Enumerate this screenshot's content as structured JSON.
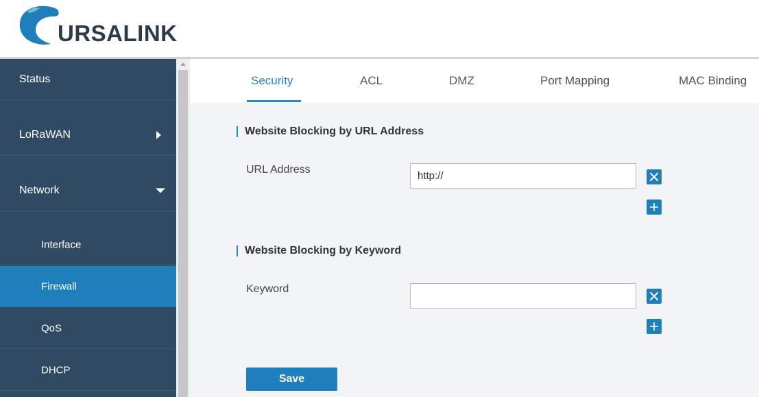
{
  "brand": {
    "logo_text": "URSALINK",
    "accent": "#1f7fba",
    "sidebar_bg": "#304a63"
  },
  "sidebar": {
    "items": [
      {
        "label": "Status"
      },
      {
        "label": "LoRaWAN",
        "icon": "chevron-right-icon"
      },
      {
        "label": "Network",
        "icon": "chevron-down-icon",
        "expanded": true
      },
      {
        "label": "Interface"
      },
      {
        "label": "Firewall",
        "active": true
      },
      {
        "label": "QoS"
      },
      {
        "label": "DHCP"
      }
    ]
  },
  "tabs": [
    {
      "label": "Security",
      "active": true
    },
    {
      "label": "ACL"
    },
    {
      "label": "DMZ"
    },
    {
      "label": "Port Mapping"
    },
    {
      "label": "MAC Binding"
    }
  ],
  "url_section": {
    "title": "Website Blocking by URL Address",
    "field_label": "URL Address",
    "value": "http://",
    "remove_icon": "close-icon",
    "add_icon": "plus-icon"
  },
  "keyword_section": {
    "title": "Website Blocking by Keyword",
    "field_label": "Keyword",
    "value": "",
    "remove_icon": "close-icon",
    "add_icon": "plus-icon"
  },
  "actions": {
    "save_label": "Save"
  }
}
